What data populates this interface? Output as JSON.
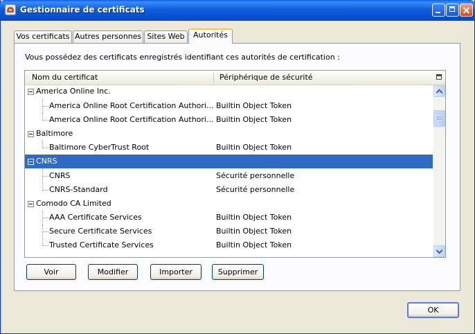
{
  "window": {
    "title": "Gestionnaire de certificats"
  },
  "tabs": [
    {
      "label": "Vos certificats"
    },
    {
      "label": "Autres personnes"
    },
    {
      "label": "Sites Web"
    },
    {
      "label": "Autorités",
      "active": true
    }
  ],
  "description": "Vous possédez des certificats enregistrés identifiant ces autorités de certification :",
  "columns": {
    "name": "Nom du certificat",
    "device": "Périphérique de sécurité"
  },
  "tree": {
    "g0": {
      "label": "America Online Inc.",
      "c0": {
        "name": "America Online Root Certification Authori...",
        "device": "Builtin Object Token"
      },
      "c1": {
        "name": "America Online Root Certification Authori...",
        "device": "Builtin Object Token"
      }
    },
    "g1": {
      "label": "Baltimore",
      "c0": {
        "name": "Baltimore CyberTrust Root",
        "device": "Builtin Object Token"
      }
    },
    "g2": {
      "label": "CNRS",
      "selected": true,
      "c0": {
        "name": "CNRS",
        "device": "Sécurité personnelle"
      },
      "c1": {
        "name": "CNRS-Standard",
        "device": "Sécurité personnelle"
      }
    },
    "g3": {
      "label": "Comodo CA Limited",
      "c0": {
        "name": "AAA Certificate Services",
        "device": "Builtin Object Token"
      },
      "c1": {
        "name": "Secure Certificate Services",
        "device": "Builtin Object Token"
      },
      "c2": {
        "name": "Trusted Certificate Services",
        "device": "Builtin Object Token"
      }
    }
  },
  "buttons": {
    "view": "Voir",
    "edit": "Modifier",
    "import": "Importer",
    "delete": "Supprimer",
    "ok": "OK"
  },
  "colors": {
    "selection": "#316ac5",
    "titlebar": "#0a5fe3",
    "dialog_bg": "#ece9d8"
  }
}
